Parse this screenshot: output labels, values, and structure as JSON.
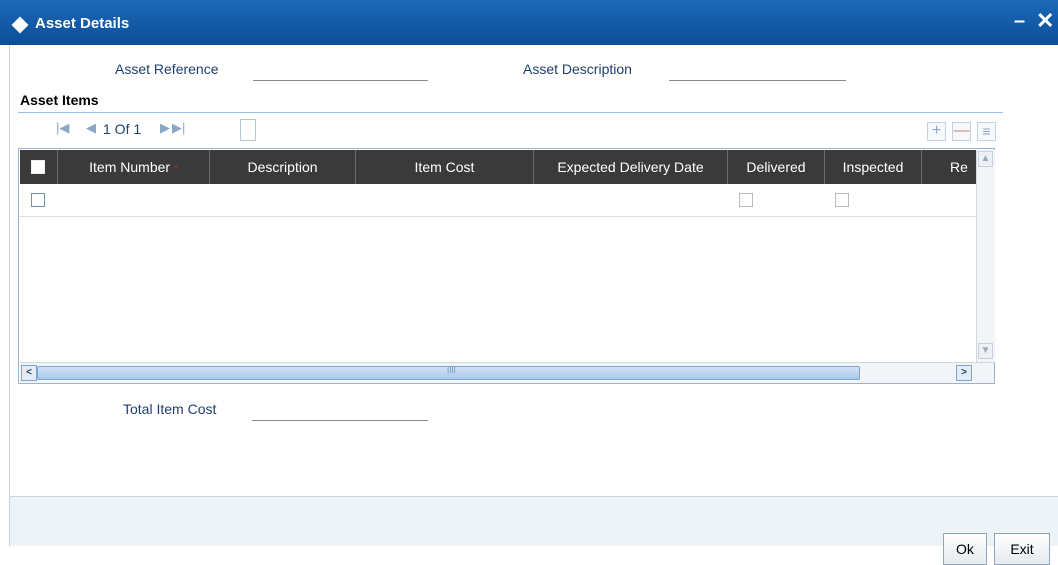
{
  "window": {
    "title": "Asset Details",
    "minimize_glyph": "–",
    "close_glyph": "✕"
  },
  "fields": {
    "asset_reference_label": "Asset Reference",
    "asset_reference_value": "",
    "asset_description_label": "Asset Description",
    "asset_description_value": ""
  },
  "asset_items": {
    "section_title": "Asset Items",
    "pager": {
      "first_glyph": "|◀",
      "prev_glyph": "◀",
      "text": "1 Of 1",
      "next_glyph": "▶",
      "last_glyph": "▶|"
    },
    "toolbar": {
      "add_glyph": "+",
      "delete_glyph": "—",
      "view_glyph": "≡"
    },
    "columns": [
      {
        "label": "Item Number",
        "required": true
      },
      {
        "label": "Description",
        "required": false
      },
      {
        "label": "Item Cost",
        "required": false
      },
      {
        "label": "Expected Delivery Date",
        "required": false
      },
      {
        "label": "Delivered",
        "required": false
      },
      {
        "label": "Inspected",
        "required": false
      },
      {
        "label": "Re",
        "required": false
      }
    ],
    "required_mark": "*",
    "rows": [
      {
        "item_number": "",
        "description": "",
        "item_cost": "",
        "expected_delivery_date": "",
        "delivered": false,
        "inspected": false
      }
    ],
    "scroll": {
      "up_glyph": "▲",
      "down_glyph": "▼",
      "left_glyph": "<",
      "right_glyph": ">",
      "grip_glyph": "IIII"
    }
  },
  "total": {
    "label": "Total Item Cost",
    "value": ""
  },
  "buttons": {
    "ok": "Ok",
    "exit": "Exit"
  },
  "colors": {
    "title_bar": "#1560b0",
    "label_text": "#1f3f6e",
    "grid_header": "#3a3a3a",
    "required_mark": "#d02020"
  }
}
